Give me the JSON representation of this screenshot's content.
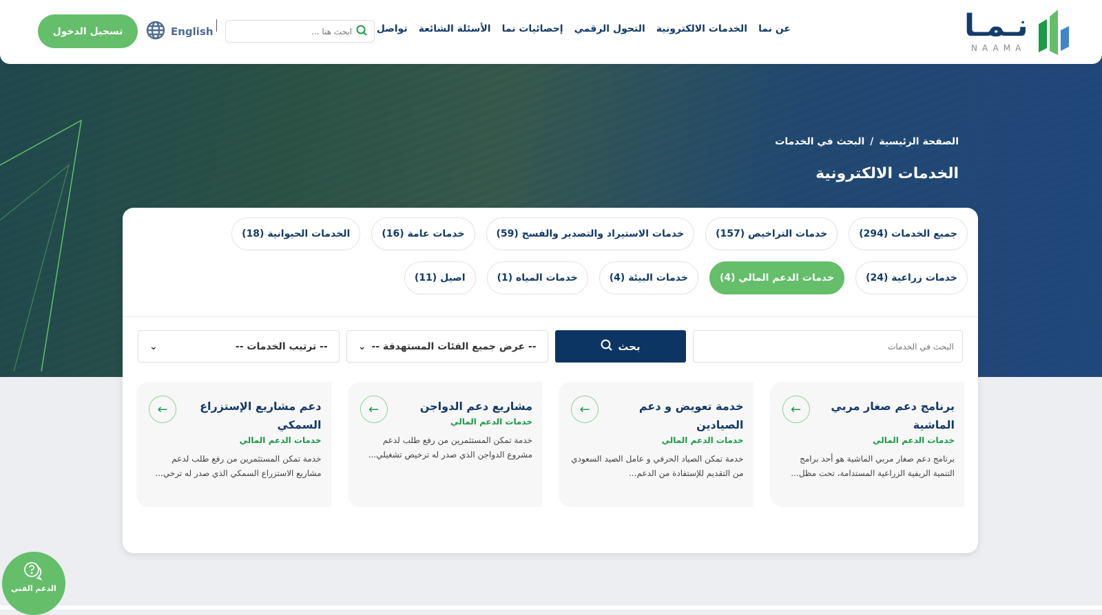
{
  "header": {
    "logo_text": "نما",
    "logo_latin": "NAAMA",
    "nav": [
      "عن نما",
      "الخدمات الالكترونية",
      "التحول الرقمي",
      "إحصائيات نما",
      "الأسئلة الشائعة",
      "تواصل معنا"
    ],
    "search_placeholder": "ابحث هنا ...",
    "language": "English",
    "login": "تسجيل الدخول"
  },
  "hero": {
    "breadcrumb": [
      "الصفحة الرئيسية",
      "/",
      "البحث في الخدمات"
    ],
    "title": "الخدمات الالكترونية"
  },
  "filters": [
    {
      "label": "جميع الخدمات (294)",
      "active": false
    },
    {
      "label": "خدمات التراخيص (157)",
      "active": false
    },
    {
      "label": "خدمات الاستيراد والتصدير والفسح (59)",
      "active": false
    },
    {
      "label": "خدمات عامة (16)",
      "active": false
    },
    {
      "label": "الخدمات الحيوانية (18)",
      "active": false
    },
    {
      "label": "خدمات زراعية (24)",
      "active": false
    },
    {
      "label": "خدمات الدعم المالي (4)",
      "active": true
    },
    {
      "label": "خدمات البيئة (4)",
      "active": false
    },
    {
      "label": "خدمات المياه (1)",
      "active": false
    },
    {
      "label": "اصيل (11)",
      "active": false
    }
  ],
  "search": {
    "placeholder": "البحث في الخدمات",
    "button": "بحث",
    "category_select": "-- عرض جميع الفئات المستهدفة --",
    "sort_select": "-- ترتيب الخدمات --"
  },
  "cards": [
    {
      "title": "برنامج دعم صغار مربي الماشية",
      "category": "خدمات الدعم المالي",
      "desc": "برنامج دعم صغار مربي الماشية هو أحد برامج التنمية الريفية الزراعية المستدامة، تحت مظل..."
    },
    {
      "title": "خدمة تعويض و دعم الصيادين",
      "category": "خدمات الدعم المالي",
      "desc": "خدمة تمكن الصياد الحرفي و عامل الصيد السعودي من التقديم للإستفادة من الدعم..."
    },
    {
      "title": "مشاريع دعم الدواجن",
      "category": "خدمات الدعم المالي",
      "desc": "خدمة تمكن المستثمرين من رفع طلب لدعم مشروع الدواجن الذي صدر له ترخيص تشغيلي..."
    },
    {
      "title": "دعم مشاريع الإستزراع السمكي",
      "category": "خدمات الدعم المالي",
      "desc": "خدمة تمكن المستثمرين من رفع طلب لدعم مشاريع الاستزراع السمكي الذي صدر له ترخي..."
    }
  ],
  "support": {
    "label": "الدعم الفني"
  },
  "colors": {
    "primary_green": "#64be6a",
    "navy": "#0d3563",
    "category_green": "#1a9b45"
  }
}
